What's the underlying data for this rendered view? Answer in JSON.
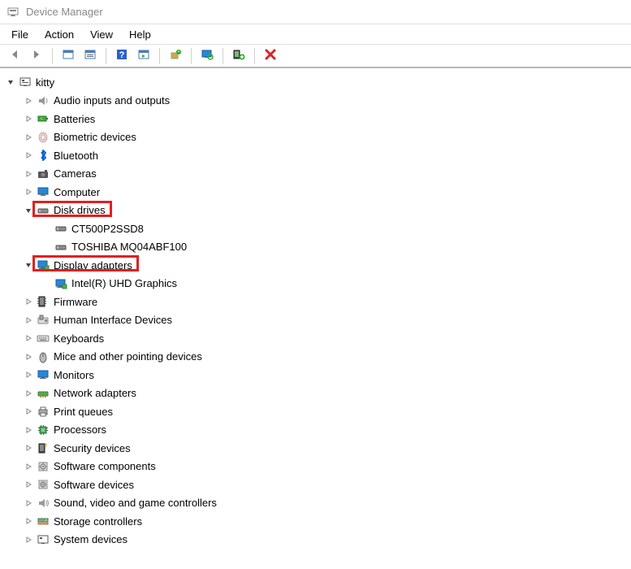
{
  "window": {
    "title": "Device Manager"
  },
  "menubar": [
    "File",
    "Action",
    "View",
    "Help"
  ],
  "toolbar": [
    {
      "name": "back-button",
      "icon": "arrow-left-icon"
    },
    {
      "name": "forward-button",
      "icon": "arrow-right-icon"
    },
    {
      "sep": true
    },
    {
      "name": "show-hidden-button",
      "icon": "panel-icon"
    },
    {
      "name": "properties-button",
      "icon": "panel-list-icon"
    },
    {
      "sep": true
    },
    {
      "name": "help-button",
      "icon": "help-icon"
    },
    {
      "name": "details-button",
      "icon": "panel-play-icon"
    },
    {
      "sep": true
    },
    {
      "name": "update-driver-button",
      "icon": "device-update-icon"
    },
    {
      "sep": true
    },
    {
      "name": "scan-hardware-button",
      "icon": "monitor-scan-icon"
    },
    {
      "sep": true
    },
    {
      "name": "add-driver-button",
      "icon": "device-add-icon"
    },
    {
      "sep": true
    },
    {
      "name": "uninstall-button",
      "icon": "delete-icon"
    }
  ],
  "tree": {
    "root": "kitty",
    "categories": [
      {
        "label": "Audio inputs and outputs",
        "icon": "speaker-icon",
        "expanded": false
      },
      {
        "label": "Batteries",
        "icon": "battery-icon",
        "expanded": false
      },
      {
        "label": "Biometric devices",
        "icon": "fingerprint-icon",
        "expanded": false
      },
      {
        "label": "Bluetooth",
        "icon": "bluetooth-icon",
        "expanded": false
      },
      {
        "label": "Cameras",
        "icon": "camera-icon",
        "expanded": false
      },
      {
        "label": "Computer",
        "icon": "computer-icon",
        "expanded": false
      },
      {
        "label": "Disk drives",
        "icon": "disk-icon",
        "expanded": true,
        "highlight": true,
        "children": [
          {
            "label": "CT500P2SSD8",
            "icon": "disk-icon"
          },
          {
            "label": "TOSHIBA MQ04ABF100",
            "icon": "disk-icon"
          }
        ]
      },
      {
        "label": "Display adapters",
        "icon": "display-adapter-icon",
        "expanded": true,
        "highlight": true,
        "children": [
          {
            "label": "Intel(R) UHD Graphics",
            "icon": "display-adapter-icon"
          }
        ]
      },
      {
        "label": "Firmware",
        "icon": "firmware-icon",
        "expanded": false
      },
      {
        "label": "Human Interface Devices",
        "icon": "hid-icon",
        "expanded": false
      },
      {
        "label": "Keyboards",
        "icon": "keyboard-icon",
        "expanded": false
      },
      {
        "label": "Mice and other pointing devices",
        "icon": "mouse-icon",
        "expanded": false
      },
      {
        "label": "Monitors",
        "icon": "monitor-icon",
        "expanded": false
      },
      {
        "label": "Network adapters",
        "icon": "network-icon",
        "expanded": false
      },
      {
        "label": "Print queues",
        "icon": "printer-icon",
        "expanded": false
      },
      {
        "label": "Processors",
        "icon": "processor-icon",
        "expanded": false
      },
      {
        "label": "Security devices",
        "icon": "security-icon",
        "expanded": false
      },
      {
        "label": "Software components",
        "icon": "software-component-icon",
        "expanded": false
      },
      {
        "label": "Software devices",
        "icon": "software-device-icon",
        "expanded": false
      },
      {
        "label": "Sound, video and game controllers",
        "icon": "sound-icon",
        "expanded": false
      },
      {
        "label": "Storage controllers",
        "icon": "storage-icon",
        "expanded": false
      },
      {
        "label": "System devices",
        "icon": "system-icon",
        "expanded": false
      }
    ]
  }
}
